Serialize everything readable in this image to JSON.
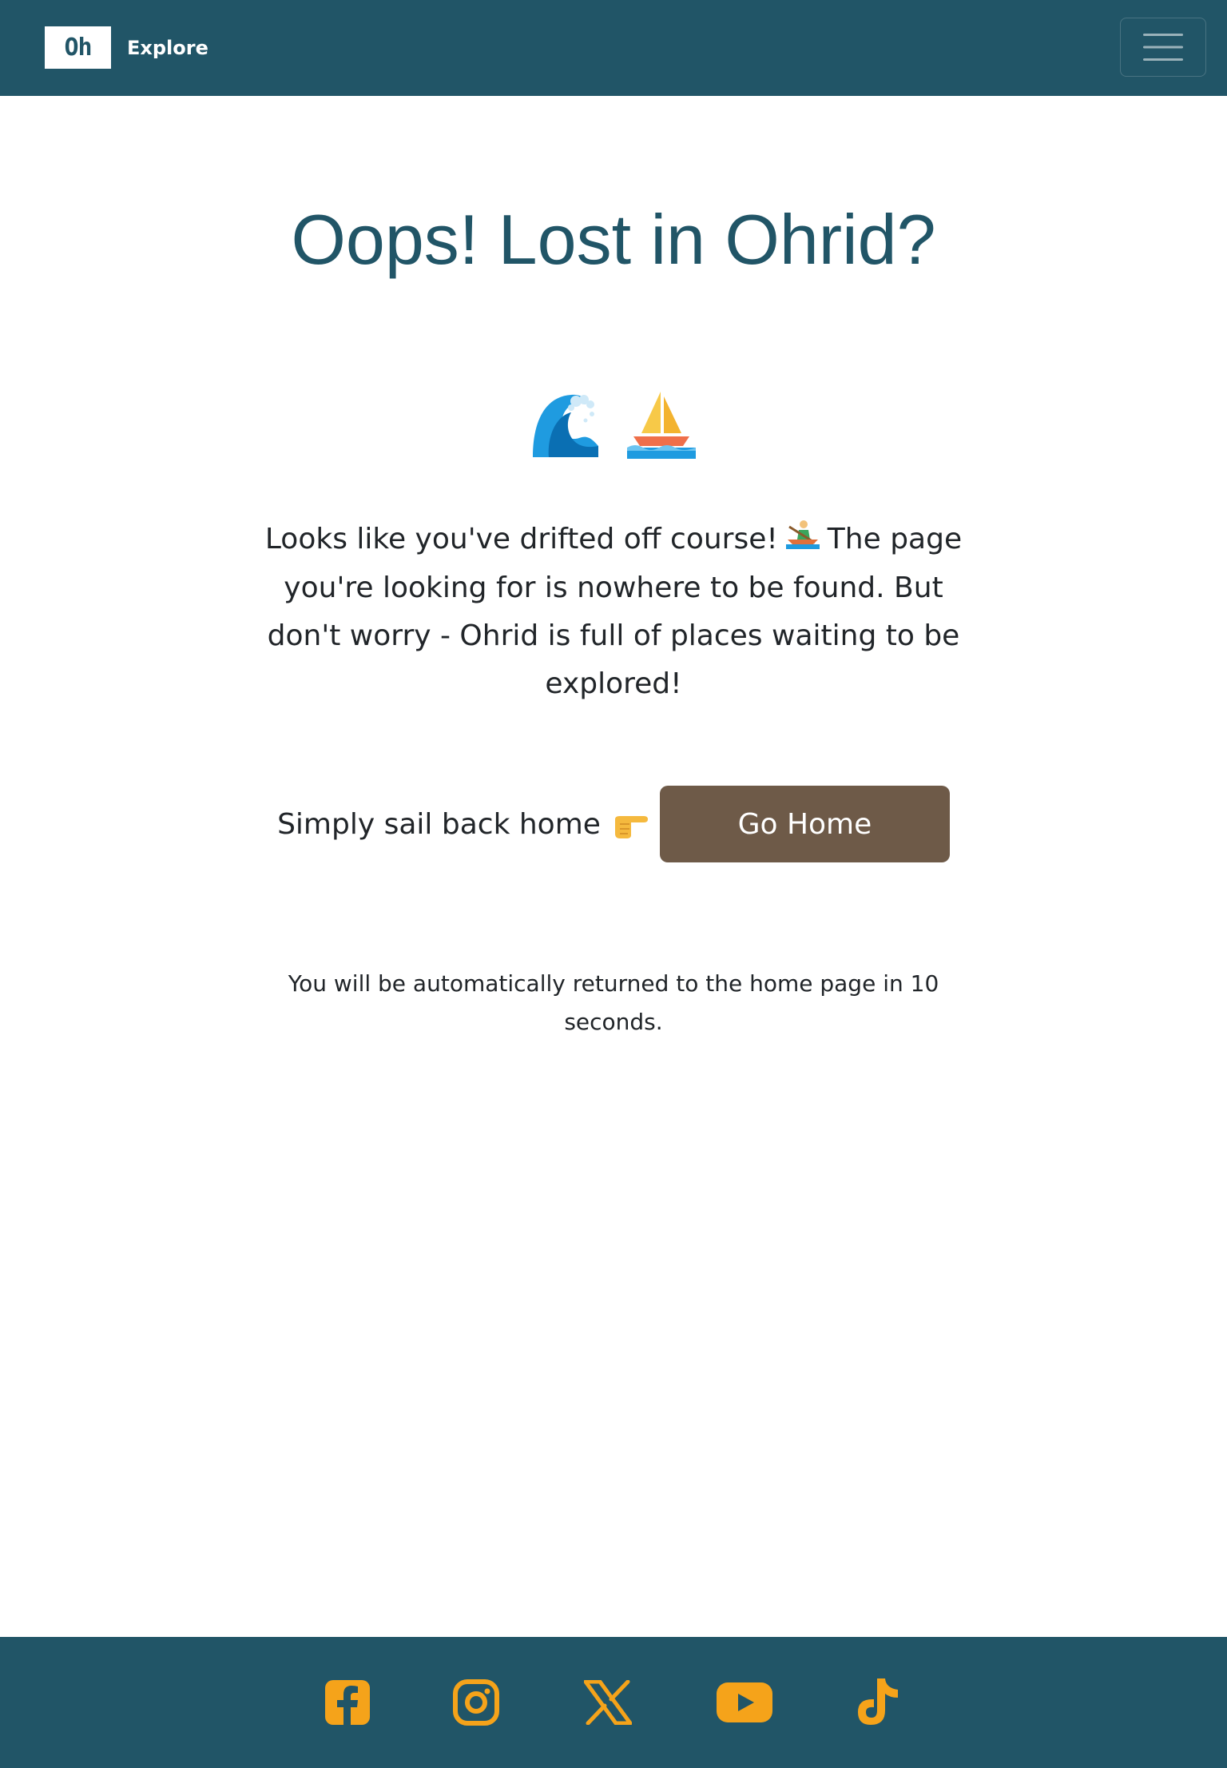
{
  "header": {
    "logo_text": "Oh",
    "brand_label": "Explore",
    "menu_toggle_icon": "hamburger-icon"
  },
  "main": {
    "title": "Oops! Lost in Ohrid?",
    "title_emojis": [
      "wave-icon",
      "sailboat-icon"
    ],
    "intro_part1": "Looks like you've drifted off course!",
    "intro_emoji": "rowboat-icon",
    "intro_part2": "The page you're looking for is nowhere to be found. But don't worry - Ohrid is full of places waiting to be explored!",
    "cta_text": "Simply sail back home",
    "cta_emoji": "pointing-right-icon",
    "button_label": "Go Home",
    "redirect_note": "You will be automatically returned to the home page in 10 seconds."
  },
  "footer": {
    "social_icons": [
      "facebook-icon",
      "instagram-icon",
      "x-icon",
      "youtube-icon",
      "tiktok-icon"
    ]
  },
  "colors": {
    "primary": "#215567",
    "button": "#6e5a48",
    "accent": "#f5a31a",
    "text": "#212529"
  }
}
